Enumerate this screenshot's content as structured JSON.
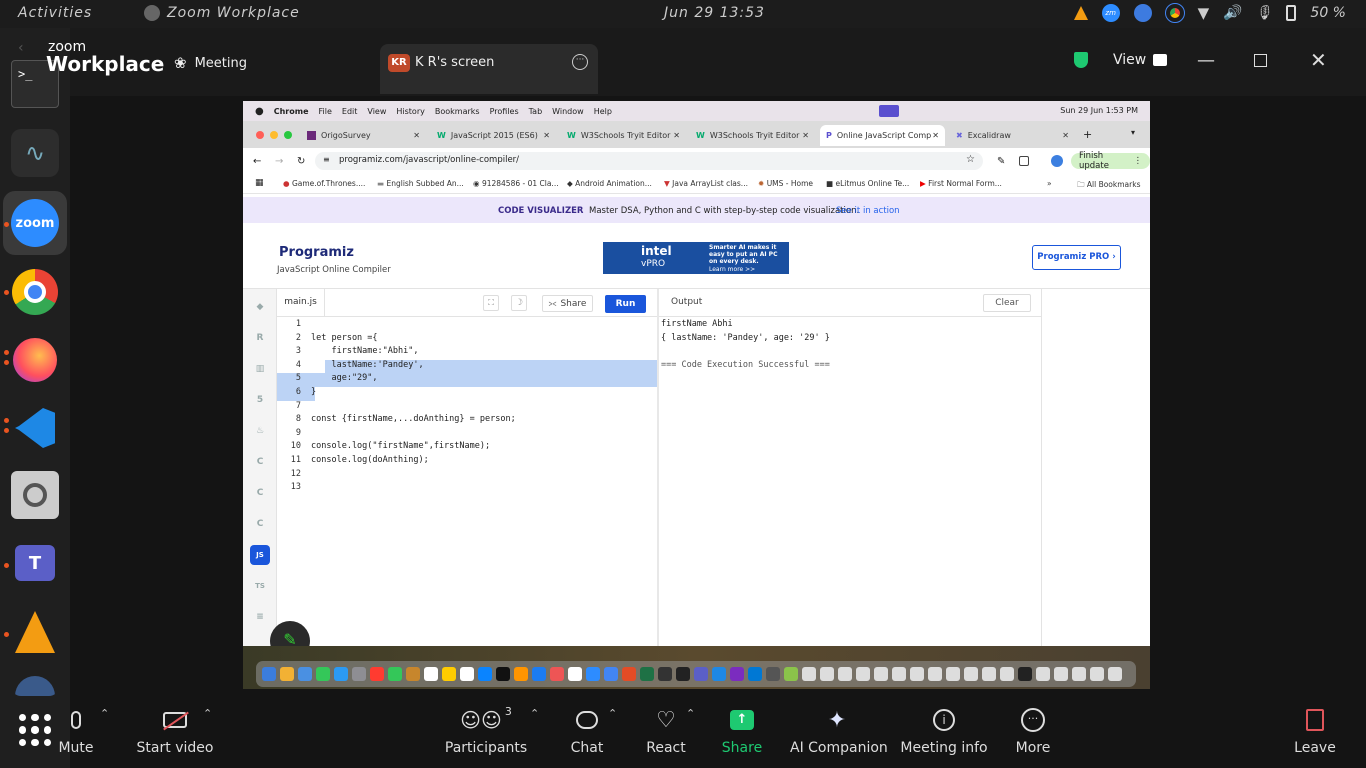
{
  "topbar": {
    "activities": "Activities",
    "app_name": "Zoom Workplace",
    "clock": "Jun 29  13:53",
    "battery": "50 %"
  },
  "zoom": {
    "logo_small": "zoom",
    "logo_big": "Workplace",
    "meeting_label": "Meeting",
    "share_avatar": "KR",
    "share_title": "K R's screen",
    "view_label": "View"
  },
  "mac": {
    "menubar": [
      "Chrome",
      "File",
      "Edit",
      "View",
      "History",
      "Bookmarks",
      "Profiles",
      "Tab",
      "Window",
      "Help"
    ],
    "clock": "Sun 29 Jun  1:53 PM",
    "tabs": [
      "OrigoSurvey",
      "JavaScript 2015 (ES6)",
      "W3Schools Tryit Editor",
      "W3Schools Tryit Editor",
      "Online JavaScript Comp",
      "Excalidraw"
    ],
    "url": "programiz.com/javascript/online-compiler/",
    "finish_update": "Finish update",
    "bookmarks": [
      "Game.of.Thrones....",
      "English Subbed An...",
      "91284586 - 01 Cla...",
      "Android Animation...",
      "Java ArrayList clas...",
      "UMS - Home",
      "eLitmus Online Te...",
      "First Normal Form..."
    ],
    "all_bookmarks": "All Bookmarks"
  },
  "programiz": {
    "banner_tag": "CODE VISUALIZER",
    "banner_text": "Master DSA, Python and C with step-by-step code visualization.",
    "banner_link": "See it in action",
    "logo": "Programiz",
    "subtitle": "JavaScript Online Compiler",
    "ad_line1": "Smarter AI makes it",
    "ad_line2": "easy to put an AI PC",
    "ad_line3": "on every desk.",
    "ad_learn": "Learn more >>",
    "ad_brand": "intel",
    "ad_vpro": "vPRO",
    "pro_button": "Programiz PRO ›",
    "file_tab": "main.js",
    "share": "Share",
    "run": "Run",
    "output_label": "Output",
    "clear": "Clear",
    "side_js": "JS",
    "side_ts": "TS",
    "code_lines": [
      "",
      "let person ={",
      "    firstName:\"Abhi\",",
      "    lastName:'Pandey',",
      "    age:\"29\",",
      "}",
      "",
      "const {firstName,...doAnthing} = person;",
      "",
      "console.log(\"firstName\",firstName);",
      "console.log(doAnthing);",
      "",
      ""
    ],
    "output_lines": [
      "firstName Abhi",
      "{ lastName: 'Pandey', age: '29' }",
      "",
      "=== Code Execution Successful ==="
    ]
  },
  "toolbar": {
    "mute": "Mute",
    "start_video": "Start video",
    "participants": "Participants",
    "participants_count": "3",
    "chat": "Chat",
    "react": "React",
    "share": "Share",
    "ai_companion": "AI Companion",
    "meeting_info": "Meeting info",
    "more": "More",
    "leave": "Leave"
  },
  "colors": {
    "share_green": "#1ec971",
    "run_blue": "#1a56db",
    "selection": "#bcd3f5",
    "leave_red": "#e0565b"
  }
}
